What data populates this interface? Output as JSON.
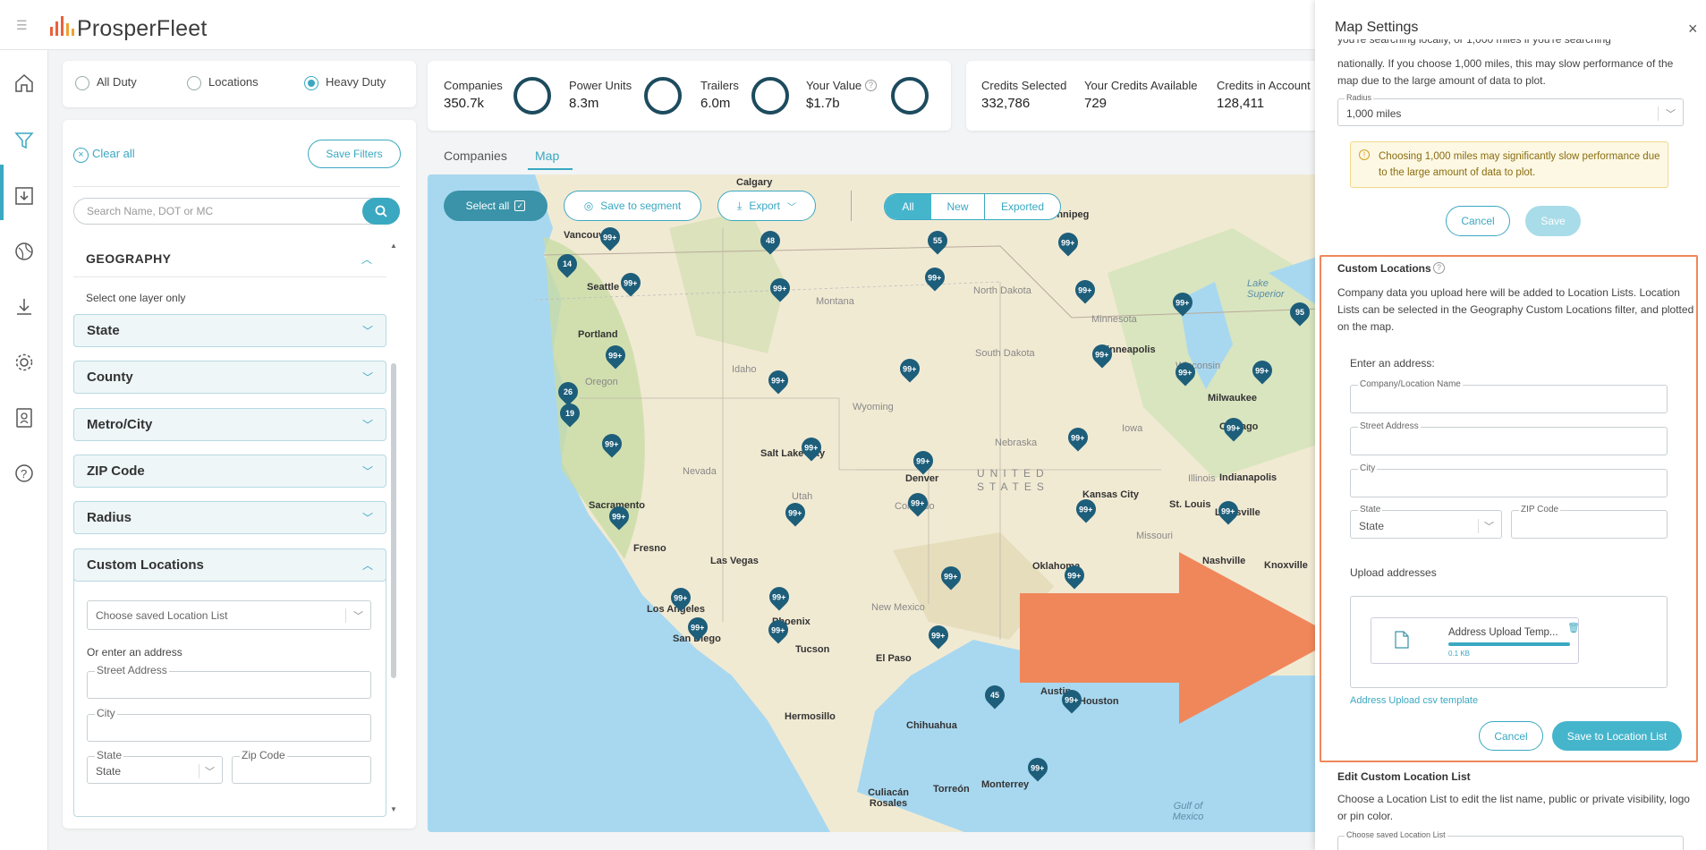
{
  "app": {
    "logo": "ProsperFleet"
  },
  "duty": {
    "options": [
      "All Duty",
      "Locations",
      "Heavy Duty"
    ],
    "selected": "Heavy Duty"
  },
  "stats": {
    "companies": {
      "label": "Companies",
      "value": "350.7k"
    },
    "power_units": {
      "label": "Power Units",
      "value": "8.3m"
    },
    "trailers": {
      "label": "Trailers",
      "value": "6.0m"
    },
    "your_value": {
      "label": "Your Value",
      "value": "$1.7b"
    },
    "credits_selected": {
      "label": "Credits Selected",
      "value": "332,786"
    },
    "credits_available": {
      "label": "Your Credits Available",
      "value": "729"
    },
    "credits_account": {
      "label": "Credits in Account",
      "value": "128,411"
    }
  },
  "filters": {
    "clear_all": "Clear all",
    "save_filters": "Save Filters",
    "search_placeholder": "Search Name, DOT or MC",
    "geography_title": "GEOGRAPHY",
    "geography_hint": "Select one layer only",
    "sections": [
      "State",
      "County",
      "Metro/City",
      "ZIP Code",
      "Radius",
      "Custom Locations"
    ],
    "custom": {
      "choose_list": "Choose saved Location List",
      "or_enter": "Or enter an address",
      "street": "Street Address",
      "city": "City",
      "state_label": "State",
      "state_value": "State",
      "zip": "Zip Code"
    }
  },
  "tabs": {
    "companies": "Companies",
    "map": "Map"
  },
  "map_toolbar": {
    "select_all": "Select all",
    "save_to_segment": "Save to segment",
    "export": "Export",
    "filter_all": "All",
    "filter_new": "New",
    "filter_exported": "Exported"
  },
  "map": {
    "cities": [
      "Vancouver",
      "Seattle",
      "Portland",
      "Sacramento",
      "Fresno",
      "Las Vegas",
      "Los Angeles",
      "San Diego",
      "Phoenix",
      "Tucson",
      "El Paso",
      "Hermosillo",
      "Chihuahua",
      "Culiacán Rosales",
      "Torreón",
      "Monterrey",
      "Salt Lake City",
      "Denver",
      "Kansas City",
      "St. Louis",
      "Louisville",
      "Indianapolis",
      "Milwaukee",
      "Chicago",
      "Minneapolis",
      "Nashville",
      "Knoxville",
      "Oklahoma",
      "Austin",
      "Houston",
      "Calgary",
      "Winnipeg"
    ],
    "regions": [
      "Montana",
      "North Dakota",
      "South Dakota",
      "Minnesota",
      "Wisconsin",
      "Oregon",
      "Idaho",
      "Wyoming",
      "Nevada",
      "Utah",
      "Colorado",
      "Nebraska",
      "Iowa",
      "Illinois",
      "Missouri",
      "New Mexico",
      "UNITED",
      "STATES",
      "Lake Superior",
      "Gulf of Mexico"
    ],
    "pins": [
      "99+",
      "48",
      "55",
      "99+",
      "14",
      "99+",
      "99+",
      "99+",
      "99+",
      "99+",
      "95",
      "99+",
      "99+",
      "99+",
      "26",
      "19",
      "99+",
      "99+",
      "99+",
      "99+",
      "99+",
      "99+",
      "99+",
      "99+",
      "99+",
      "99+",
      "99+",
      "99+",
      "99+",
      "99+",
      "99+",
      "99+",
      "99+",
      "45",
      "99+",
      "99+",
      "99+",
      "99+",
      "99+"
    ]
  },
  "panel": {
    "title": "Map Settings",
    "intro_cut": "you're searching locally, or 1,000 miles if you're searching",
    "intro": "nationally. If you choose 1,000 miles, this may slow performance of the map due to the large amount of data to plot.",
    "radius_label": "Radius",
    "radius_value": "1,000 miles",
    "warning": "Choosing 1,000 miles may significantly slow performance due to the large amount of data to plot.",
    "cancel": "Cancel",
    "save": "Save",
    "custom_title": "Custom Locations",
    "custom_desc": "Company data you upload here will be added to Location Lists. Location Lists can be selected in the Geography Custom Locations filter, and plotted on the map.",
    "enter_address": "Enter an address:",
    "company_name": "Company/Location Name",
    "street": "Street Address",
    "city": "City",
    "state_label": "State",
    "state_value": "State",
    "zip": "ZIP Code",
    "upload_title": "Upload addresses",
    "file_name": "Address Upload Temp...",
    "file_size": "0.1 KB",
    "template_link": "Address Upload csv template",
    "cancel2": "Cancel",
    "save_list": "Save to Location List",
    "edit_title": "Edit Custom Location List",
    "edit_desc": "Choose a Location List to edit the list name, public or private visibility, logo or pin color.",
    "choose_label": "Choose saved Location List"
  },
  "colors": {
    "accent": "#3aa8c1",
    "pin": "#1d5e7a",
    "highlight": "#f0875a",
    "warning_bg": "#fdf8e4"
  }
}
